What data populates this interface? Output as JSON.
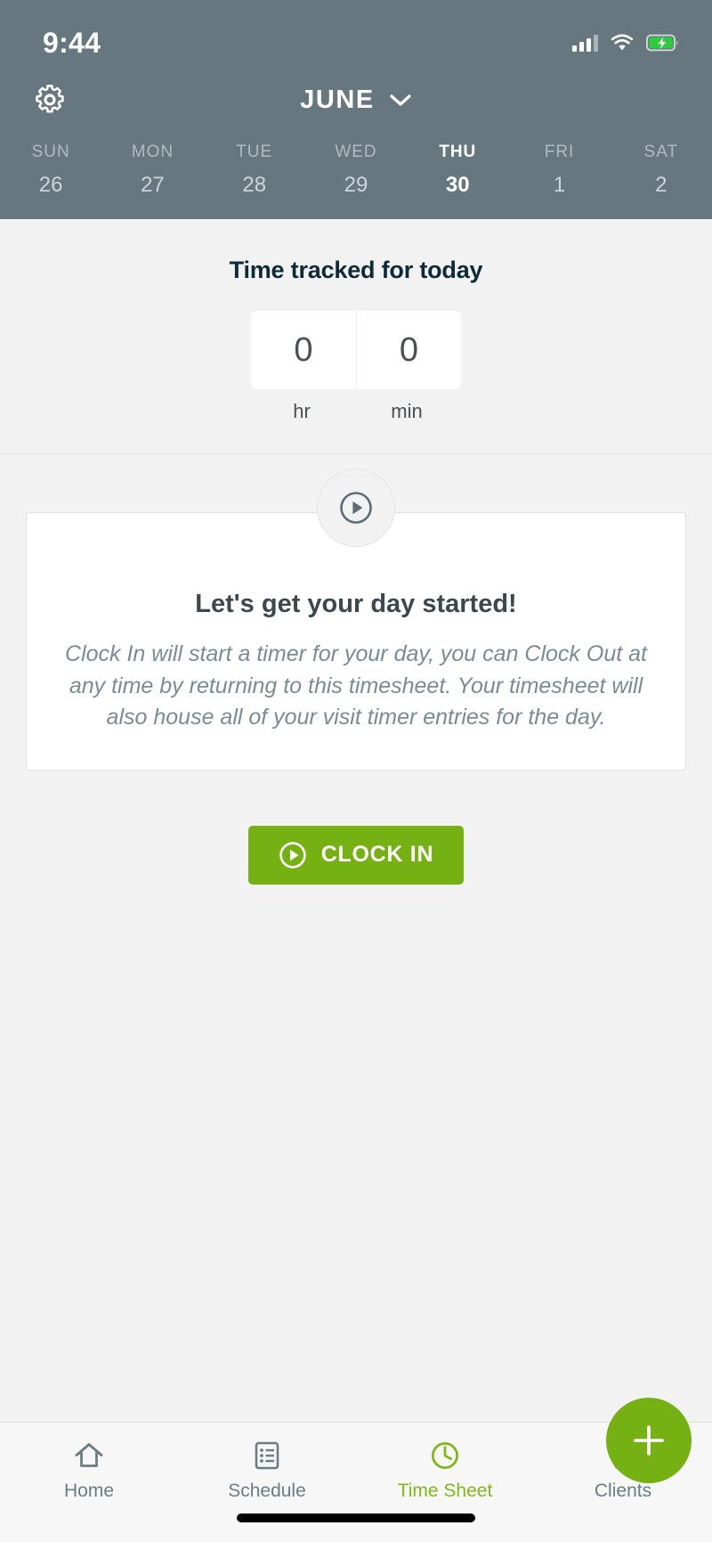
{
  "status_bar": {
    "time": "9:44",
    "cellular_icon": "cellular-signal-icon",
    "wifi_icon": "wifi-icon",
    "battery_icon": "battery-charging-icon"
  },
  "header": {
    "settings_icon": "gear-icon",
    "month": "JUNE",
    "month_chevron_icon": "chevron-down-icon",
    "accent_color": "#82b81a",
    "background_color": "#67777f",
    "days": [
      {
        "dow": "SUN",
        "num": "26",
        "active": false
      },
      {
        "dow": "MON",
        "num": "27",
        "active": false
      },
      {
        "dow": "TUE",
        "num": "28",
        "active": false
      },
      {
        "dow": "WED",
        "num": "29",
        "active": false
      },
      {
        "dow": "THU",
        "num": "30",
        "active": true
      },
      {
        "dow": "FRI",
        "num": "1",
        "active": false
      },
      {
        "dow": "SAT",
        "num": "2",
        "active": false
      }
    ]
  },
  "tracked": {
    "title": "Time tracked for today",
    "hours_value": "0",
    "minutes_value": "0",
    "hours_label": "hr",
    "minutes_label": "min"
  },
  "info_card": {
    "play_icon": "play-circle-icon",
    "title": "Let's get your day started!",
    "text": "Clock In will start a timer for your day, you can Clock Out at any time by returning to this timesheet. Your timesheet will also house all of your visit timer entries for the day."
  },
  "clock_in": {
    "label": "CLOCK IN",
    "icon": "play-circle-icon",
    "color": "#76b113"
  },
  "tabbar": {
    "tabs": [
      {
        "label": "Home",
        "icon": "home-icon",
        "active": false
      },
      {
        "label": "Schedule",
        "icon": "list-icon",
        "active": false
      },
      {
        "label": "Time Sheet",
        "icon": "clock-icon",
        "active": true
      },
      {
        "label": "Clients",
        "icon": "contact-book-icon",
        "active": false
      }
    ],
    "fab": {
      "icon": "plus-icon",
      "color": "#76b113"
    }
  }
}
